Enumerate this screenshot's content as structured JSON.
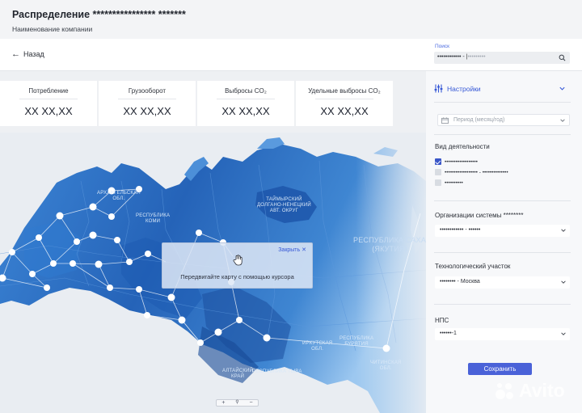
{
  "header": {
    "title": "Распределение **************** *******",
    "company": "Наименование компании"
  },
  "toolbar": {
    "back_label": "Назад",
    "search_label": "Поиск",
    "search_value": "•••••••••••• -",
    "search_placeholder": "•••••••••"
  },
  "cards": [
    {
      "label": "Потребление",
      "value": "XX XX,XX"
    },
    {
      "label": "Грузооборот",
      "value": "XX XX,XX"
    },
    {
      "label": "Выбросы CO₂",
      "value": "XX XX,XX"
    },
    {
      "label": "Удельные выбросы CO₂",
      "value": "XX XX,XX"
    }
  ],
  "map": {
    "labels": {
      "arkhangelsk": "АРХАНГЕЛЬСКАЯ\nОБЛ.",
      "komi": "РЕСПУБЛИКА\nКОМИ",
      "taimyr": "ТАЙМЫРСКИЙ\nДОЛГАНО-НЕНЕЦКИЙ\nАВТ. ОКРУГ",
      "sakha": "РЕСПУБЛИКА САХА\n(ЯКУТИЯ)",
      "irkutsk": "ИРКУТСКАЯ\nОБЛ.",
      "buryatia": "РЕСПУБЛИКА\nБУРЯТИЯ",
      "chita": "ЧИТИНСКАЯ\nОБЛ.",
      "tuva": "РЕСПУБЛИКА ТЫВА",
      "altai_krai": "АЛТАЙСКИЙ\nКРАЙ"
    },
    "popup": {
      "close_label": "Закрыть",
      "hint": "Передвигайте карту с помощью курсора"
    },
    "zoom": {
      "plus": "+",
      "minus": "−"
    }
  },
  "panel": {
    "settings_label": "Настройки",
    "period_placeholder": "Период (месяц/год)",
    "activity_title": "Вид деятельности",
    "activities": [
      {
        "label": "••••••••••••••••••",
        "checked": true
      },
      {
        "label": "•••••••••••••••••• - ••••••••••••••",
        "checked": false
      },
      {
        "label": "••••••••••",
        "checked": false
      }
    ],
    "org_title": "Организации системы ********",
    "org_value": "•••••••••••• - ••••••",
    "tech_title": "Технологический участок",
    "tech_value": "•••••••• - Москва",
    "nps_title": "НПС",
    "nps_value": "••••••-1",
    "save_label": "Сохранить"
  },
  "watermark": {
    "text": "Avito"
  },
  "colors": {
    "accent": "#3557d6",
    "button": "#4a62d8",
    "map_light": "#7cb4ea",
    "map_dark": "#1a4fa6"
  }
}
